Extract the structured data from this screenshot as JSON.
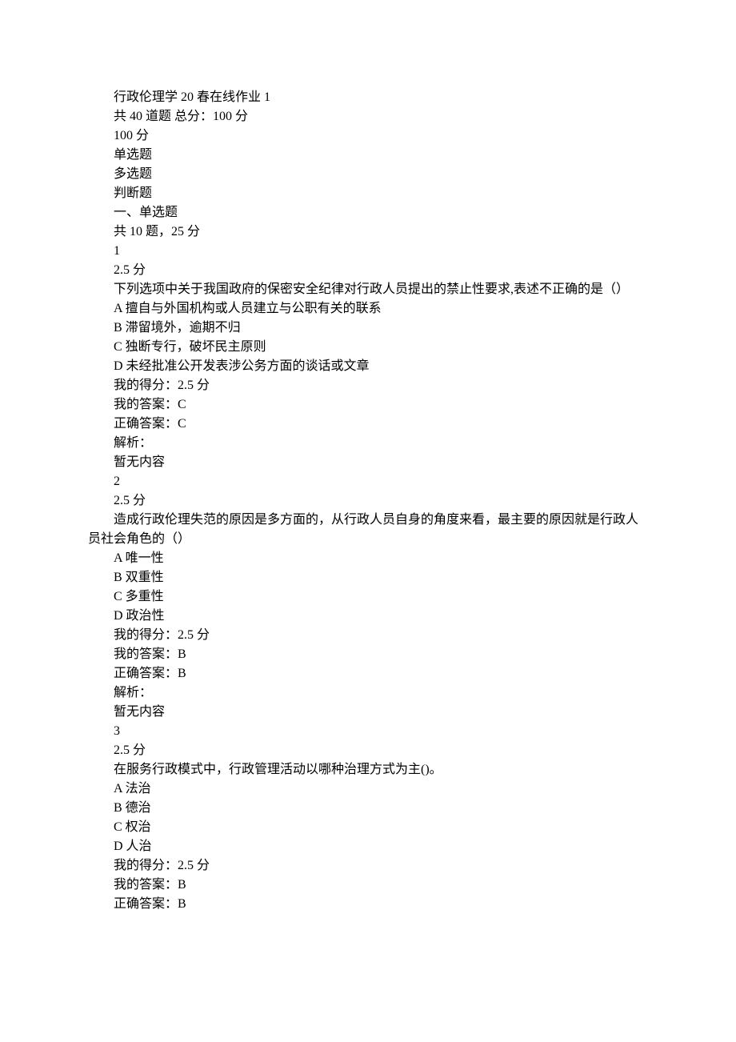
{
  "header": {
    "title": "行政伦理学 20 春在线作业 1",
    "count_line": "共 40 道题  总分：100 分",
    "score": "100 分",
    "type_single": "单选题",
    "type_multi": "多选题",
    "type_judge": "判断题",
    "section1_title": "一、单选题",
    "section1_sub": "共 10 题，25 分"
  },
  "q1": {
    "num": "1",
    "points": "2.5 分",
    "stem": "下列选项中关于我国政府的保密安全纪律对行政人员提出的禁止性要求,表述不正确的是（）",
    "optA": "A 擅自与外国机构或人员建立与公职有关的联系",
    "optB": "B 滞留境外，逾期不归",
    "optC": "C 独断专行，破坏民主原则",
    "optD": "D 未经批准公开发表涉公务方面的谈话或文章",
    "my_score": "我的得分：2.5 分",
    "my_ans": "我的答案：C",
    "correct": "正确答案：C",
    "explain_label": "解析：",
    "explain_body": "暂无内容"
  },
  "q2": {
    "num": "2",
    "points": "2.5 分",
    "stem": "造成行政伦理失范的原因是多方面的，从行政人员自身的角度来看，最主要的原因就是行政人员社会角色的（）",
    "optA": "A 唯一性",
    "optB": "B 双重性",
    "optC": "C 多重性",
    "optD": "D 政治性",
    "my_score": "我的得分：2.5 分",
    "my_ans": "我的答案：B",
    "correct": "正确答案：B",
    "explain_label": "解析：",
    "explain_body": "暂无内容"
  },
  "q3": {
    "num": "3",
    "points": "2.5 分",
    "stem": "在服务行政模式中，行政管理活动以哪种治理方式为主()。",
    "optA": "A 法治",
    "optB": "B 德治",
    "optC": "C 权治",
    "optD": "D 人治",
    "my_score": "我的得分：2.5 分",
    "my_ans": "我的答案：B",
    "correct": "正确答案：B"
  }
}
